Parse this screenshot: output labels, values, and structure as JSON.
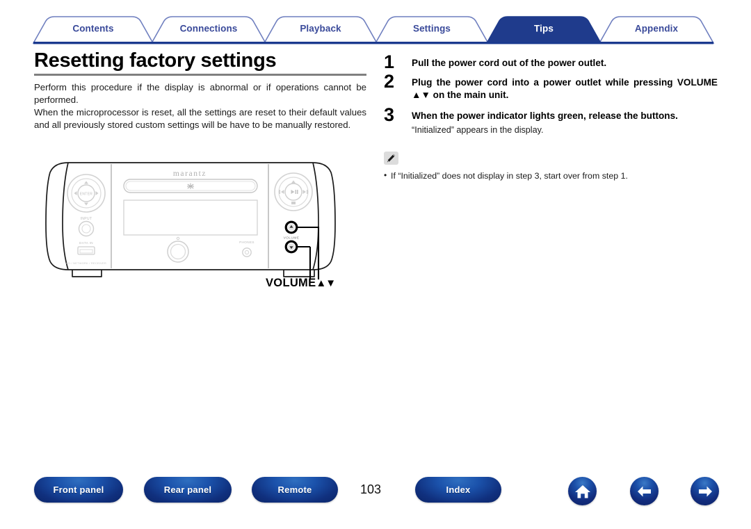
{
  "colors": {
    "tab_text": "#3a4a9a",
    "tab_active_bg": "#1f3b8c",
    "tab_border": "#6f7fbf",
    "rule_blue": "#1b3a8f",
    "title_rule_gray": "#808080",
    "pill_blue": "#1b52ab"
  },
  "tabs": [
    {
      "label": "Contents",
      "active": false
    },
    {
      "label": "Connections",
      "active": false
    },
    {
      "label": "Playback",
      "active": false
    },
    {
      "label": "Settings",
      "active": false
    },
    {
      "label": "Tips",
      "active": true
    },
    {
      "label": "Appendix",
      "active": false
    }
  ],
  "left": {
    "title": "Resetting factory settings",
    "paragraphs": [
      "Perform this procedure if the display is abnormal or if operations cannot be performed.",
      "When the microprocessor is reset, all the settings are reset to their default values and all previously stored custom settings will be have to be manually restored."
    ],
    "figure": {
      "brand": "marantz",
      "caption": "VOLUME",
      "caption_arrows": "▲▼",
      "labels": {
        "enter": "ENTER",
        "input": "INPUT",
        "usb": "DATA IN",
        "model_note": "CD / NETWORK / RECEIVER",
        "volume": "VOLUME",
        "phones": "PHONES"
      }
    }
  },
  "right": {
    "steps": [
      {
        "number": "1",
        "text": "Pull the power cord out of the power outlet.",
        "sub": ""
      },
      {
        "number": "2",
        "text": "Plug the power cord into a power outlet while pressing VOLUME ▲▼ on the main unit.",
        "sub": ""
      },
      {
        "number": "3",
        "text": "When the power indicator lights green, release the buttons.",
        "sub": "“Initialized” appears in the display."
      }
    ],
    "note": {
      "icon": "pencil-icon",
      "items": [
        "If “Initialized” does not display in step 3, start over from step 1."
      ]
    }
  },
  "bottom": {
    "buttons": [
      {
        "label": "Front panel"
      },
      {
        "label": "Rear panel"
      },
      {
        "label": "Remote"
      },
      {
        "label": "Index"
      }
    ],
    "page_number": "103",
    "icons": [
      {
        "name": "home-icon"
      },
      {
        "name": "arrow-left-icon"
      },
      {
        "name": "arrow-right-icon"
      }
    ]
  }
}
